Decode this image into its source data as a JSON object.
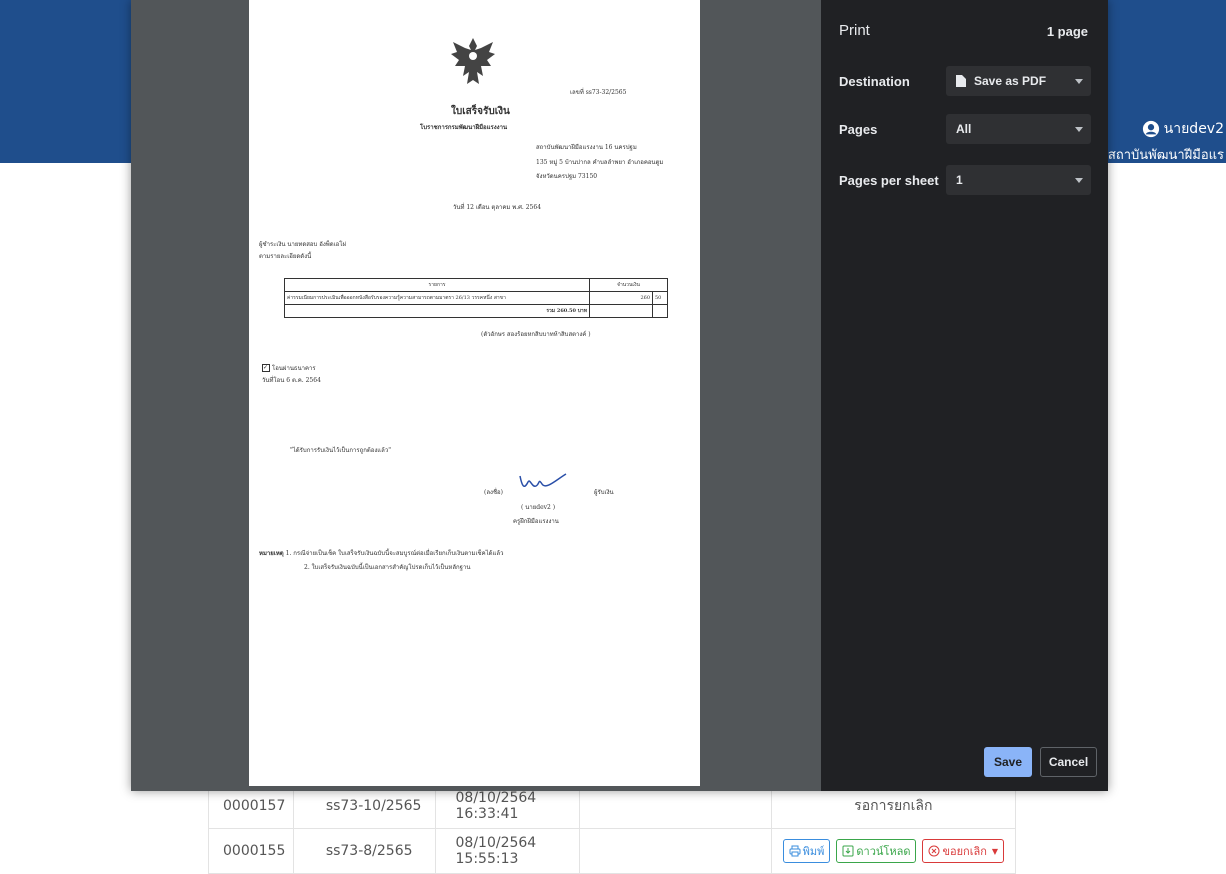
{
  "user": {
    "name": "นายdev2",
    "org": "สถาบันพัฒนาฝีมือแร"
  },
  "table": {
    "rows": [
      {
        "id": "0000157",
        "code": "ss73-10/2565",
        "datetime": "08/10/2564 16:33:41",
        "status": "รอการยกเลิก"
      },
      {
        "id": "0000155",
        "code": "ss73-8/2565",
        "datetime": "08/10/2564 15:55:13"
      }
    ],
    "actions": {
      "print": "พิมพ์",
      "download": "ดาวน์โหลด",
      "cancel": "ขอยกเลิก"
    }
  },
  "print_dialog": {
    "title": "Print",
    "page_count": "1 page",
    "destination_label": "Destination",
    "destination_value": "Save as PDF",
    "pages_label": "Pages",
    "pages_value": "All",
    "per_sheet_label": "Pages per sheet",
    "per_sheet_value": "1",
    "save": "Save",
    "cancel": "Cancel"
  },
  "document": {
    "number": "เลขที่ ss73-32/2565",
    "title": "ใบเสร็จรับเงิน",
    "subtitle": "โบราชการกรมพัฒนาฝีมือแรงงาน",
    "addr1": "สถาบันพัฒนาฝีมือแรงงาน 16 นครปฐม",
    "addr2": "135 หมู่ 5 บ้านปากล คำบลลำพยา อำเภอคอนตูม",
    "addr3": "จังหวัดนครปฐม 73150",
    "date": "วันที่ 12 เดือน ตุลาคม พ.ศ. 2564",
    "payer": "ผู้ชำระเงิน นายทดสอบ อังพ็ดเอโผ่",
    "detail": "ตามรายละเอียดดังนี้",
    "col_item": "รายการ",
    "col_amount": "จำนวนเงิน",
    "item": "ค่ารรมเนียมการประเมินเพื่อออกหนังสือรับรองความรู้ความสามารถตามมาตรา 26/13 วรรคหนึ่ง สาขา",
    "amount_baht": "260",
    "amount_satang": "50",
    "total": "รวม  260.50  บาท",
    "total_words": "(ตัวอักษร สองร้อยหกสิบบาทห้าสิบสตางค์ )",
    "bank": "โอนผ่านธนาคาร",
    "bank_date": "วันที่โอน 6 ต.ค. 2564",
    "received": "\"ได้รับการรับเงินไว้เป็นการถูกต้องแล้ว\"",
    "sign_prefix": "(ลงชื่อ)",
    "sign_suffix": "ผู้รับเงิน",
    "signer": "( นายdev2 )",
    "signer_title": "ครูฝึกฝีมือแรงงาน",
    "note_label": "หมายเหตุ",
    "note1": "1. กรณีจ่ายเป็นเช็ค ใบเสร็จรับเงินฉบับนี้จะสมบูรณ์ต่อเมื่อเรียกเก็บเงินตามเช็คได้แล้ว",
    "note2": "2. ใบเสร็จรับเงินฉบับนี้เป็นเอกสารสำคัญโปรดเก็บไว้เป็นหลักฐาน"
  }
}
